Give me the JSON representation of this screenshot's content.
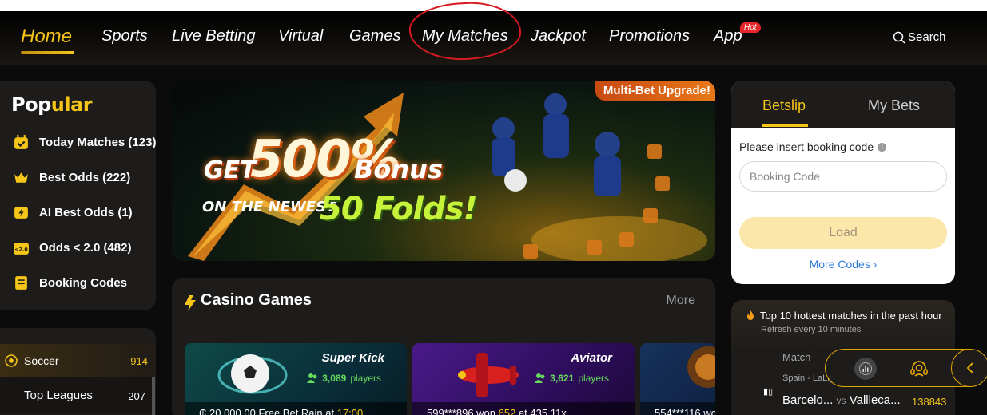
{
  "nav": {
    "items": [
      {
        "label": "Home",
        "active": true
      },
      {
        "label": "Sports"
      },
      {
        "label": "Live Betting"
      },
      {
        "label": "Virtual"
      },
      {
        "label": "Games"
      },
      {
        "label": "My Matches",
        "highlighted": true
      },
      {
        "label": "Jackpot"
      },
      {
        "label": "Promotions"
      },
      {
        "label": "App",
        "badge": "Hot"
      }
    ],
    "search_label": "Search"
  },
  "popular": {
    "title_part1": "Pop",
    "title_part2": "ular",
    "items": [
      {
        "label": "Today Matches (123)",
        "icon": "calendar-icon"
      },
      {
        "label": "Best Odds (222)",
        "icon": "crown-icon"
      },
      {
        "label": "AI Best Odds (1)",
        "icon": "lightning-icon"
      },
      {
        "label": "Odds < 2.0 (482)",
        "icon": "odds-icon"
      },
      {
        "label": "Booking Codes",
        "icon": "document-icon"
      }
    ]
  },
  "sports": {
    "soccer_label": "Soccer",
    "soccer_count": "914",
    "top_leagues_label": "Top Leagues",
    "top_leagues_count": "207"
  },
  "banner": {
    "corner_label": "Multi-Bet Upgrade!",
    "get": "GET",
    "percent": "500%",
    "bonus": "Bonus",
    "newest": "ON THE NEWEST",
    "folds": "50 Folds!"
  },
  "casino": {
    "title": "Casino Games",
    "more_label": "More",
    "games": [
      {
        "name": "Super Kick",
        "players": "3,089",
        "players_suffix": "players",
        "footer_pre": "₵ 20,000.00  Free Bet Rain at ",
        "footer_highlight": "17:00",
        "footer_post": ""
      },
      {
        "name": "Aviator",
        "players": "3,621",
        "players_suffix": "players",
        "footer_pre": "599***896 won ",
        "footer_highlight": "652",
        "footer_post": " at 435.11x"
      },
      {
        "name": "",
        "players": "",
        "players_suffix": "",
        "footer_pre": "554***116 wo",
        "footer_highlight": "",
        "footer_post": ""
      }
    ]
  },
  "betslip": {
    "tab_active": "Betslip",
    "tab_inactive": "My Bets",
    "prompt": "Please insert booking code",
    "input_placeholder": "Booking Code",
    "load_label": "Load",
    "more_codes": "More Codes"
  },
  "hottest": {
    "title": "Top 10 hottest matches in the past hour",
    "subtitle": "Refresh every 10 minutes",
    "match_header": "Match",
    "league": "Spain - LaLig",
    "home": "Barcelo...",
    "vs": "vs",
    "away": "Vallleca...",
    "count": "138843"
  },
  "colors": {
    "accent": "#f5c518",
    "annotation_circle": "#d71920",
    "link": "#2f7bdc"
  }
}
